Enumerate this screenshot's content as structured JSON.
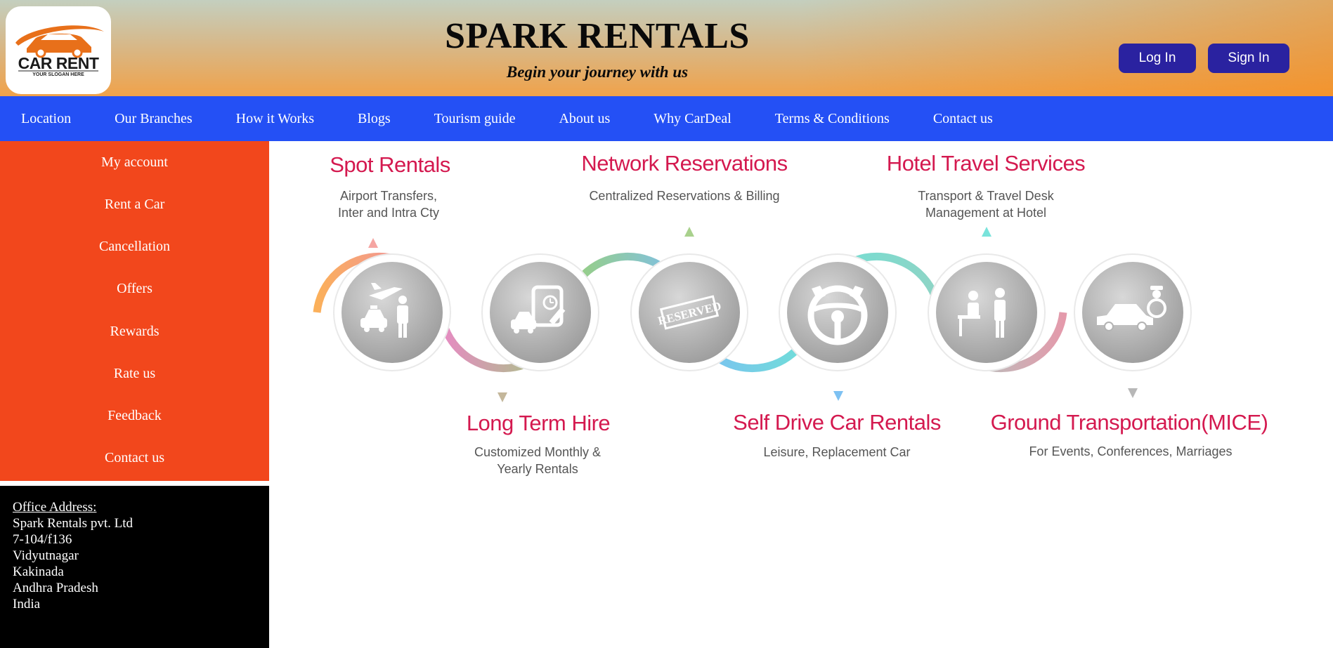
{
  "header": {
    "logo": {
      "brand": "CAR RENT",
      "slogan": "YOUR SLOGAN HERE"
    },
    "title": "SPARK RENTALS",
    "tagline": "Begin your journey with us",
    "login_label": "Log In",
    "signin_label": "Sign In"
  },
  "nav": {
    "items": [
      "Location",
      "Our Branches",
      "How it Works",
      "Blogs",
      "Tourism guide",
      "About us",
      "Why CarDeal",
      "Terms & Conditions",
      "Contact us"
    ]
  },
  "sidebar": {
    "items": [
      "My account",
      "Rent a Car",
      "Cancellation",
      "Offers",
      "Rewards",
      "Rate us",
      "Feedback",
      "Contact us"
    ]
  },
  "address": {
    "heading": "Office Address:",
    "lines": [
      "Spark Rentals pvt. Ltd",
      "7-104/f136",
      "Vidyutnagar",
      "Kakinada",
      "Andhra Pradesh",
      "India"
    ]
  },
  "services": [
    {
      "title": "Spot Rentals",
      "subtitle_lines": [
        "Airport Transfers,",
        "Inter and Intra Cty"
      ],
      "icon": "taxi-airplane-person-icon"
    },
    {
      "title": "Long Term Hire",
      "subtitle_lines": [
        "Customized Monthly &",
        "Yearly Rentals"
      ],
      "icon": "calendar-car-icon"
    },
    {
      "title": "Network Reservations",
      "subtitle_lines": [
        "Centralized Reservations & Billing"
      ],
      "icon": "reserved-stamp-icon"
    },
    {
      "title": "Self Drive Car Rentals",
      "subtitle_lines": [
        "Leisure, Replacement Car"
      ],
      "icon": "steering-wheel-icon"
    },
    {
      "title": "Hotel Travel Services",
      "subtitle_lines": [
        "Transport & Travel Desk",
        "Management at Hotel"
      ],
      "icon": "hotel-desk-icon"
    },
    {
      "title": "Ground Transportation(MICE)",
      "subtitle_lines": [
        "For Events, Conferences, Marriages"
      ],
      "icon": "chauffeur-car-icon"
    }
  ],
  "reserved_stamp_text": "RESERVED",
  "colors": {
    "nav_blue": "#2450f5",
    "sidebar_orange": "#f2471c",
    "auth_button": "#2a22a0",
    "service_title": "#d4194f",
    "address_bg": "#000000"
  }
}
